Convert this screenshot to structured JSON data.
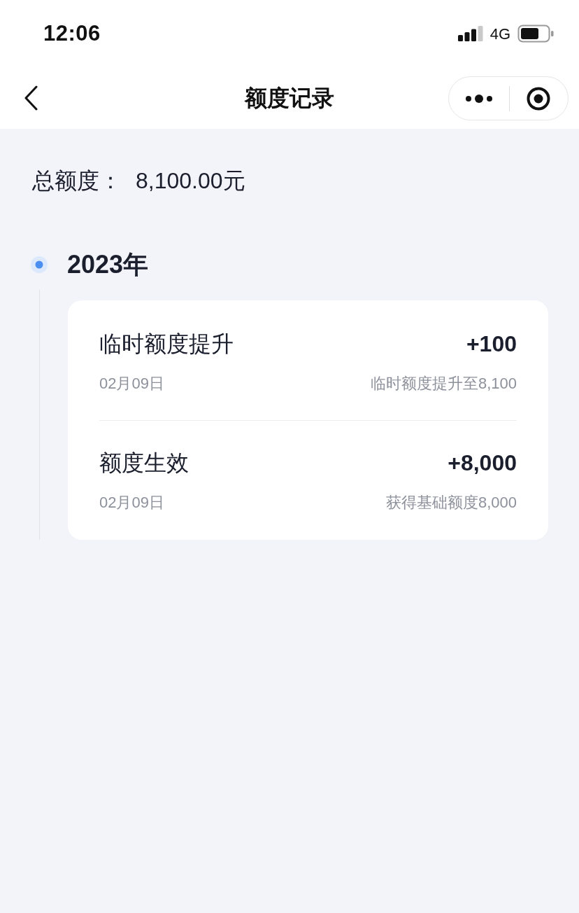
{
  "status_bar": {
    "time": "12:06",
    "network": "4G"
  },
  "nav": {
    "title": "额度记录"
  },
  "total": {
    "label": "总额度：",
    "value": "8,100.00元"
  },
  "timeline": [
    {
      "year": "2023年",
      "records": [
        {
          "title": "临时额度提升",
          "amount": "+100",
          "date": "02月09日",
          "note": "临时额度提升至8,100"
        },
        {
          "title": "额度生效",
          "amount": "+8,000",
          "date": "02月09日",
          "note": "获得基础额度8,000"
        }
      ]
    }
  ]
}
